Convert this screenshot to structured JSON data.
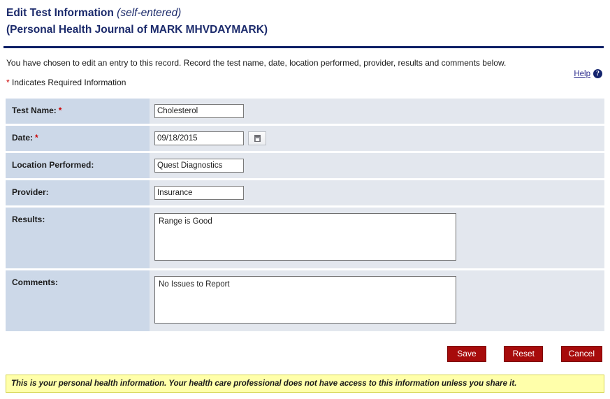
{
  "header": {
    "title_main": "Edit Test Information",
    "title_self_entered": "(self-entered)",
    "title_line2": "(Personal Health Journal of MARK MHVDAYMARK)"
  },
  "intro": {
    "description": "You have chosen to edit an entry to this record. Record the test name, date, location performed, provider, results and comments below.",
    "required_note_star": "*",
    "required_note": " Indicates Required Information"
  },
  "help": {
    "label": "Help",
    "icon": "question-mark-icon"
  },
  "form": {
    "rows": {
      "test_name": {
        "label": "Test Name:",
        "required_marker": "*",
        "value": "Cholesterol"
      },
      "date": {
        "label": "Date:",
        "required_marker": "*",
        "value": "09/18/2015",
        "calendar_icon": "calendar-icon"
      },
      "location_performed": {
        "label": "Location Performed:",
        "value": "Quest Diagnostics"
      },
      "provider": {
        "label": "Provider:",
        "value": "Insurance"
      },
      "results": {
        "label": "Results:",
        "value": "Range is Good"
      },
      "comments": {
        "label": "Comments:",
        "value": "No Issues to Report"
      }
    }
  },
  "buttons": {
    "save": "Save",
    "reset": "Reset",
    "cancel": "Cancel"
  },
  "footer": {
    "notice": "This is your personal health information. Your health care professional does not have access to this information unless you share it."
  },
  "colors": {
    "header_blue": "#1b2a6b",
    "rule_blue": "#0d1f66",
    "label_cell": "#ccd8e8",
    "field_cell": "#e3e7ee",
    "button_red": "#a70b0b",
    "notice_yellow": "#ffffaa",
    "required_red": "#cc0000",
    "link_blue": "#2a2a8c"
  }
}
